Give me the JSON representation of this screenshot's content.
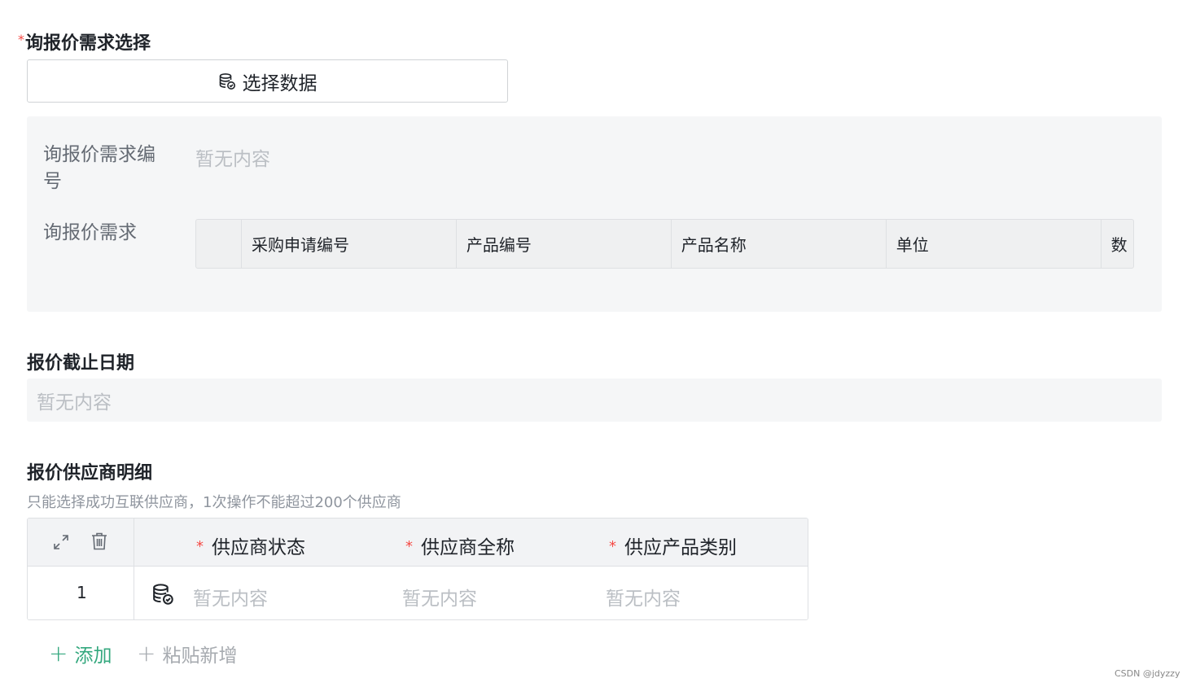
{
  "demand_section": {
    "title": "询报价需求选择",
    "required_mark": "*",
    "select_button_label": "选择数据",
    "code_label": "询报价需求编号",
    "code_value": "暂无内容",
    "demand_label": "询报价需求",
    "demand_columns": [
      "",
      "采购申请编号",
      "产品编号",
      "产品名称",
      "单位",
      "数"
    ]
  },
  "deadline_section": {
    "title": "报价截止日期",
    "value": "暂无内容"
  },
  "supplier_section": {
    "title": "报价供应商明细",
    "hint": "只能选择成功互联供应商，1次操作不能超过200个供应商",
    "columns": [
      {
        "required": "*",
        "label": "供应商状态"
      },
      {
        "required": "*",
        "label": "供应商全称"
      },
      {
        "required": "*",
        "label": "供应产品类别"
      }
    ],
    "rows": [
      {
        "index": "1",
        "status": "暂无内容",
        "name": "暂无内容",
        "category": "暂无内容"
      }
    ],
    "add_label": "添加",
    "paste_label": "粘贴新增",
    "add_color": "#34a87e"
  },
  "watermark": "CSDN @jdyzzy"
}
